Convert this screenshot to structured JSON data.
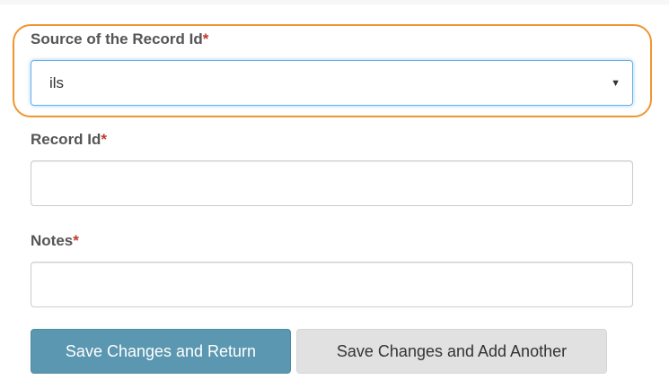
{
  "form": {
    "source_label": "Source of the Record Id",
    "source_required_mark": "*",
    "source_selected": "ils",
    "source_caret": "▼",
    "record_id_label": "Record Id",
    "record_id_required_mark": "*",
    "record_id_value": "",
    "notes_label": "Notes",
    "notes_required_mark": "*",
    "notes_value": ""
  },
  "buttons": {
    "save_return": "Save Changes and Return",
    "save_add_another": "Save Changes and Add Another"
  },
  "colors": {
    "highlight": "#f0962e",
    "primary_button": "#5b97b0",
    "secondary_button": "#e1e1e1",
    "required_mark": "#c0392b",
    "focus_border": "#66afe9"
  }
}
